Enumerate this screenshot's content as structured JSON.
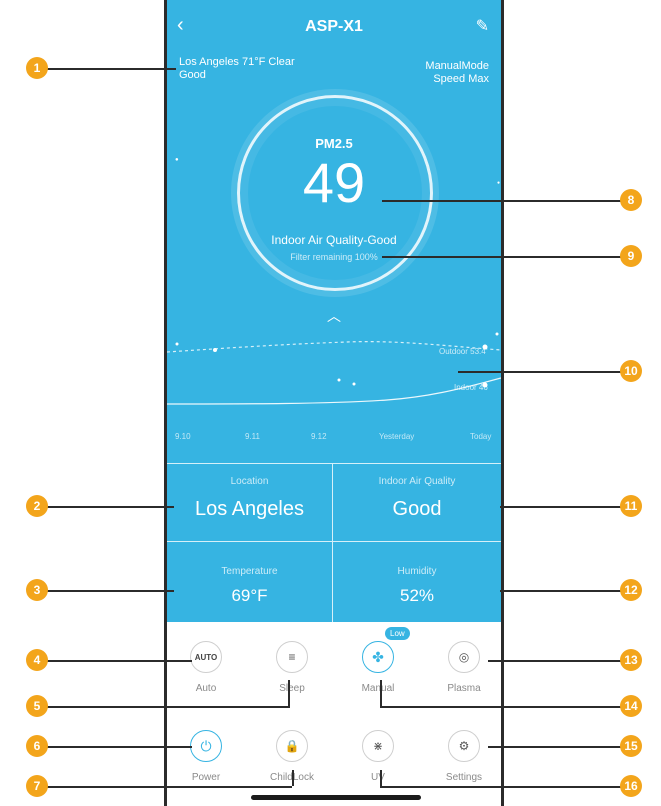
{
  "header": {
    "title": "ASP-X1",
    "back_icon": "chevron-left-icon",
    "edit_icon": "pencil-icon"
  },
  "weather": {
    "line1": "Los Angeles 71°F Clear",
    "line2": "Good"
  },
  "mode": {
    "line1": "ManualMode",
    "line2": "Speed Max"
  },
  "gauge": {
    "label": "PM2.5",
    "value": "49",
    "quality": "Indoor Air Quality-Good",
    "filter": "Filter remaining 100%"
  },
  "chart_data": {
    "type": "line",
    "categories": [
      "9.10",
      "9.11",
      "9.12",
      "Yesterday",
      "Today"
    ],
    "series": [
      {
        "name": "Outdoor 53.4",
        "style": "dashed"
      },
      {
        "name": "Indoor 46",
        "style": "solid"
      }
    ]
  },
  "stats": {
    "location": {
      "label": "Location",
      "value": "Los Angeles"
    },
    "air_quality": {
      "label": "Indoor Air Quality",
      "value": "Good"
    },
    "temperature": {
      "label": "Temperature",
      "value": "69°F"
    },
    "humidity": {
      "label": "Humidity",
      "value": "52%"
    }
  },
  "controls": {
    "auto": {
      "icon_text": "AUTO",
      "label": "Auto"
    },
    "sleep": {
      "icon": "sleep-icon",
      "label": "Sleep"
    },
    "manual": {
      "icon": "fan-icon",
      "label": "Manual",
      "badge": "Low"
    },
    "plasma": {
      "icon": "plasma-icon",
      "label": "Plasma"
    },
    "power": {
      "icon": "power-icon",
      "label": "Power"
    },
    "childlock": {
      "icon": "lock-icon",
      "label": "ChildLock"
    },
    "uv": {
      "icon": "uv-icon",
      "label": "UV"
    },
    "settings": {
      "icon": "gear-icon",
      "label": "Settings"
    }
  },
  "callouts": [
    "1",
    "2",
    "3",
    "4",
    "5",
    "6",
    "7",
    "8",
    "9",
    "10",
    "11",
    "12",
    "13",
    "14",
    "15",
    "16"
  ],
  "colors": {
    "primary": "#36b4e2",
    "callout": "#f3a51b"
  }
}
